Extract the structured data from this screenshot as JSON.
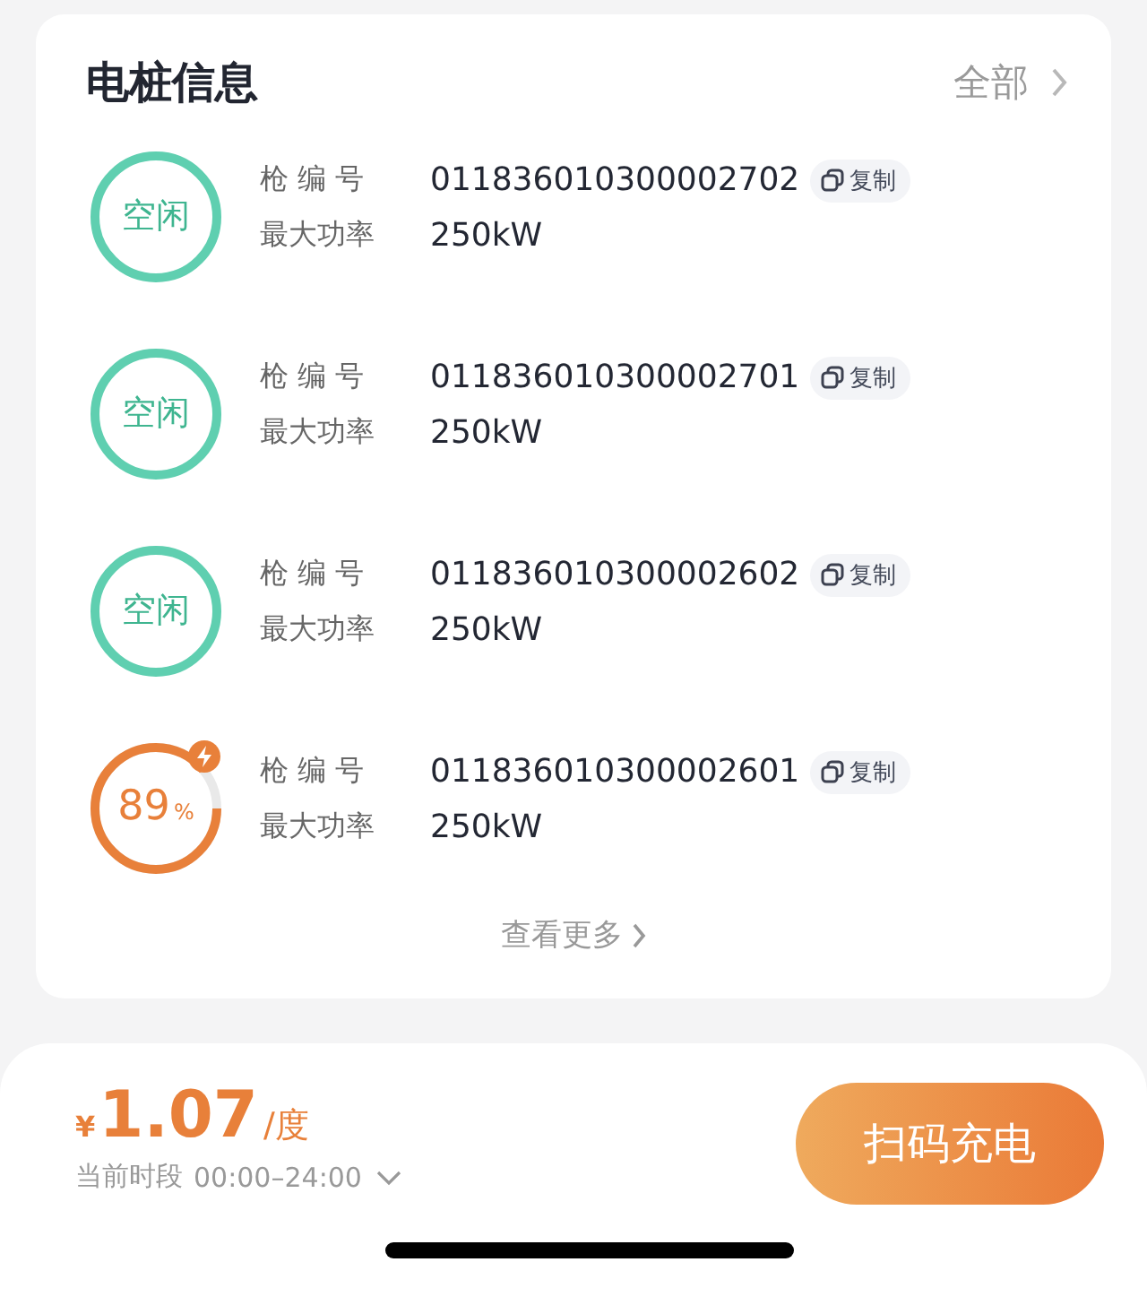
{
  "header": {
    "title": "电桩信息",
    "link": "全部"
  },
  "piles": [
    {
      "kind": "idle",
      "status": "空闲",
      "gun_label": "枪 编 号",
      "gun_number": "011836010300002702",
      "copy": "复制",
      "power_label": "最大功率",
      "power": "250kW"
    },
    {
      "kind": "idle",
      "status": "空闲",
      "gun_label": "枪 编 号",
      "gun_number": "011836010300002701",
      "copy": "复制",
      "power_label": "最大功率",
      "power": "250kW"
    },
    {
      "kind": "idle",
      "status": "空闲",
      "gun_label": "枪 编 号",
      "gun_number": "011836010300002602",
      "copy": "复制",
      "power_label": "最大功率",
      "power": "250kW"
    },
    {
      "kind": "charging",
      "status": "89",
      "unit": "%",
      "level": 0.89,
      "gun_label": "枪 编 号",
      "gun_number": "011836010300002601",
      "copy": "复制",
      "power_label": "最大功率",
      "power": "250kW"
    }
  ],
  "more": "查看更多",
  "footer": {
    "currency": "¥",
    "price": "1.07",
    "unit": "/度",
    "period_label": "当前时段",
    "period": "00:00–24:00",
    "button": "扫码充电"
  }
}
